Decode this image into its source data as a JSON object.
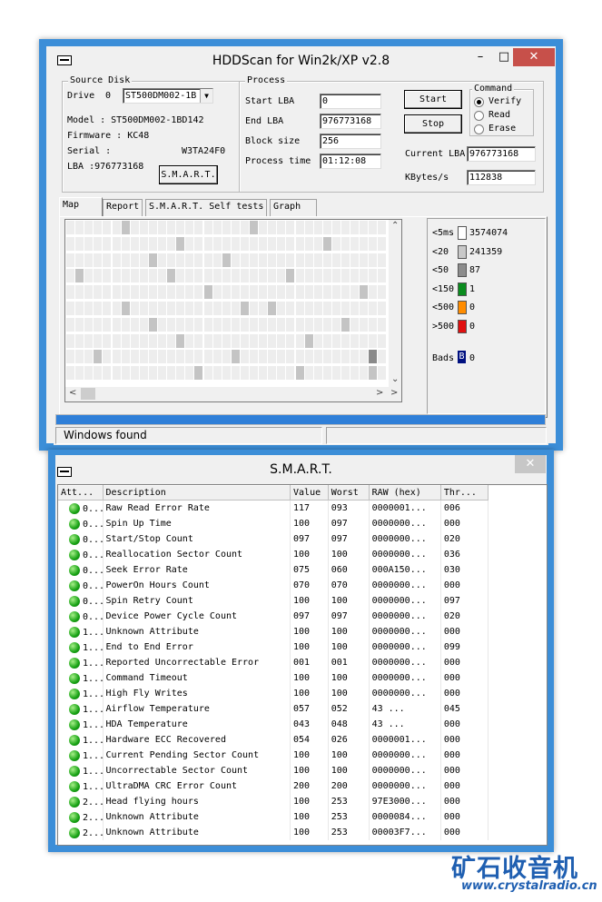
{
  "main_window": {
    "title": "HDDScan for Win2k/XP  v2.8",
    "minimize": "–",
    "maximize": "□",
    "close": "✕",
    "source_disk": {
      "label": "Source Disk",
      "drive_label": "Drive",
      "drive_index": "0",
      "drive_select": "ST500DM002-1B",
      "model": "Model : ST500DM002-1BD142",
      "firmware": "Firmware : KC48",
      "serial_label": "Serial :",
      "serial_value": "W3TA24F0",
      "lba": "LBA :976773168",
      "smart_button": "S.M.A.R.T."
    },
    "process": {
      "label": "Process",
      "start_lba_label": "Start LBA",
      "start_lba": "0",
      "end_lba_label": "End LBA",
      "end_lba": "976773168",
      "block_size_label": "Block size",
      "block_size": "256",
      "process_time_label": "Process time",
      "process_time": "01:12:08",
      "start_button": "Start",
      "stop_button": "Stop",
      "current_lba_label": "Current LBA",
      "current_lba": "976773168",
      "kbytes_label": "KBytes/s",
      "kbytes": "112838"
    },
    "command": {
      "label": "Command",
      "options": [
        "Verify",
        "Read",
        "Erase"
      ],
      "selected": "Verify"
    },
    "tabs": [
      "Map",
      "Report",
      "S.M.A.R.T.  Self tests",
      "Graph"
    ],
    "legend": [
      {
        "label": "<5ms",
        "count": "3574074",
        "color": "#ffffff"
      },
      {
        "label": "<20",
        "count": "241359",
        "color": "#c8c8c8"
      },
      {
        "label": "<50",
        "count": "87",
        "color": "#8c8c8c"
      },
      {
        "label": "<150",
        "count": "1",
        "color": "#0a8c1e"
      },
      {
        "label": "<500",
        "count": "0",
        "color": "#ff8c00"
      },
      {
        "label": ">500",
        "count": "0",
        "color": "#e01010"
      }
    ],
    "bads": {
      "label": "Bads",
      "count": "0",
      "glyph": "B",
      "color": "#001080"
    },
    "progress": 1.0,
    "status": "Windows  found"
  },
  "smart_window": {
    "title": "S.M.A.R.T.",
    "close": "✕",
    "columns": [
      "Att...",
      "Description",
      "Value",
      "Worst",
      "RAW (hex)",
      "Thr..."
    ],
    "rows": [
      {
        "att": "0...",
        "desc": "Raw Read Error Rate",
        "value": "117",
        "worst": "093",
        "raw": "0000001...",
        "thr": "006"
      },
      {
        "att": "0...",
        "desc": "Spin Up Time",
        "value": "100",
        "worst": "097",
        "raw": "0000000...",
        "thr": "000"
      },
      {
        "att": "0...",
        "desc": "Start/Stop Count",
        "value": "097",
        "worst": "097",
        "raw": "0000000...",
        "thr": "020"
      },
      {
        "att": "0...",
        "desc": "Reallocation Sector Count",
        "value": "100",
        "worst": "100",
        "raw": "0000000...",
        "thr": "036"
      },
      {
        "att": "0...",
        "desc": "Seek Error Rate",
        "value": "075",
        "worst": "060",
        "raw": "000A150...",
        "thr": "030"
      },
      {
        "att": "0...",
        "desc": "PowerOn Hours Count",
        "value": "070",
        "worst": "070",
        "raw": "0000000...",
        "thr": "000"
      },
      {
        "att": "0...",
        "desc": "Spin Retry Count",
        "value": "100",
        "worst": "100",
        "raw": "0000000...",
        "thr": "097"
      },
      {
        "att": "0...",
        "desc": "Device Power Cycle Count",
        "value": "097",
        "worst": "097",
        "raw": "0000000...",
        "thr": "020"
      },
      {
        "att": "1...",
        "desc": "Unknown Attribute",
        "value": "100",
        "worst": "100",
        "raw": "0000000...",
        "thr": "000"
      },
      {
        "att": "1...",
        "desc": "End to End Error",
        "value": "100",
        "worst": "100",
        "raw": "0000000...",
        "thr": "099"
      },
      {
        "att": "1...",
        "desc": "Reported Uncorrectable Error",
        "value": "001",
        "worst": "001",
        "raw": "0000000...",
        "thr": "000"
      },
      {
        "att": "1...",
        "desc": "Command Timeout",
        "value": "100",
        "worst": "100",
        "raw": "0000000...",
        "thr": "000"
      },
      {
        "att": "1...",
        "desc": "High Fly Writes",
        "value": "100",
        "worst": "100",
        "raw": "0000000...",
        "thr": "000"
      },
      {
        "att": "1...",
        "desc": "Airflow Temperature",
        "value": "057",
        "worst": "052",
        "raw": "43     ...",
        "thr": "045"
      },
      {
        "att": "1...",
        "desc": "HDA Temperature",
        "value": "043",
        "worst": "048",
        "raw": "43     ...",
        "thr": "000"
      },
      {
        "att": "1...",
        "desc": "Hardware ECC Recovered",
        "value": "054",
        "worst": "026",
        "raw": "0000001...",
        "thr": "000"
      },
      {
        "att": "1...",
        "desc": "Current Pending Sector Count",
        "value": "100",
        "worst": "100",
        "raw": "0000000...",
        "thr": "000"
      },
      {
        "att": "1...",
        "desc": "Uncorrectable Sector Count",
        "value": "100",
        "worst": "100",
        "raw": "0000000...",
        "thr": "000"
      },
      {
        "att": "1...",
        "desc": "UltraDMA CRC Error Count",
        "value": "200",
        "worst": "200",
        "raw": "0000000...",
        "thr": "000"
      },
      {
        "att": "2...",
        "desc": "Head flying hours",
        "value": "100",
        "worst": "253",
        "raw": "97E3000...",
        "thr": "000"
      },
      {
        "att": "2...",
        "desc": "Unknown Attribute",
        "value": "100",
        "worst": "253",
        "raw": "0000084...",
        "thr": "000"
      },
      {
        "att": "2...",
        "desc": "Unknown Attribute",
        "value": "100",
        "worst": "253",
        "raw": "00003F7...",
        "thr": "000"
      }
    ]
  },
  "watermark": {
    "brand": "矿石收音机",
    "url": "www.crystalradio.cn"
  }
}
